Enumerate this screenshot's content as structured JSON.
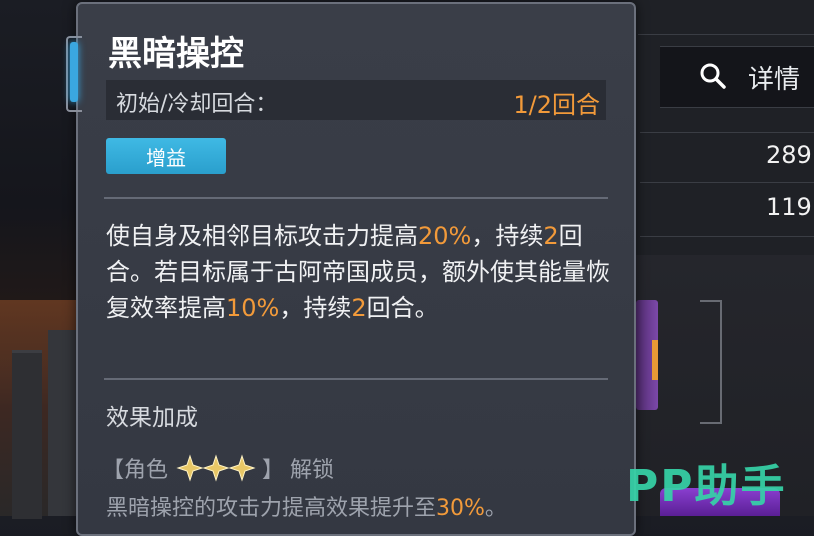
{
  "skill": {
    "title": "黑暗操控",
    "cooldown_label": "初始/冷却回合：",
    "cooldown_value": "1/2回合",
    "tag": "增益",
    "description": {
      "p1": "使自身及相邻目标攻击力提高",
      "v1": "20%",
      "p2": "，持续",
      "v2": "2",
      "p3": "回合。若目标属于古阿帝国成员，额外使其能量恢复效率提高",
      "v3": "10%",
      "p4": "，持续",
      "v4": "2",
      "p5": "回合。"
    },
    "effect_section_title": "效果加成",
    "unlock": {
      "open_bracket": "【",
      "role_label": "角色",
      "close_bracket": "】",
      "suffix": "解锁",
      "stars": 3
    },
    "bonus": {
      "text": "黑暗操控的攻击力提高效果提升至",
      "value": "30%",
      "end": "。"
    }
  },
  "side_panel": {
    "detail_label": "详情",
    "stats": [
      "289",
      "119"
    ]
  },
  "icons": {
    "detail": "search-icon",
    "star": "gold-star-icon"
  },
  "watermark": "PP助手",
  "colors": {
    "highlight": "#f29a3a",
    "tag": "#3fb9e4",
    "watermark": "#36d3a8"
  }
}
